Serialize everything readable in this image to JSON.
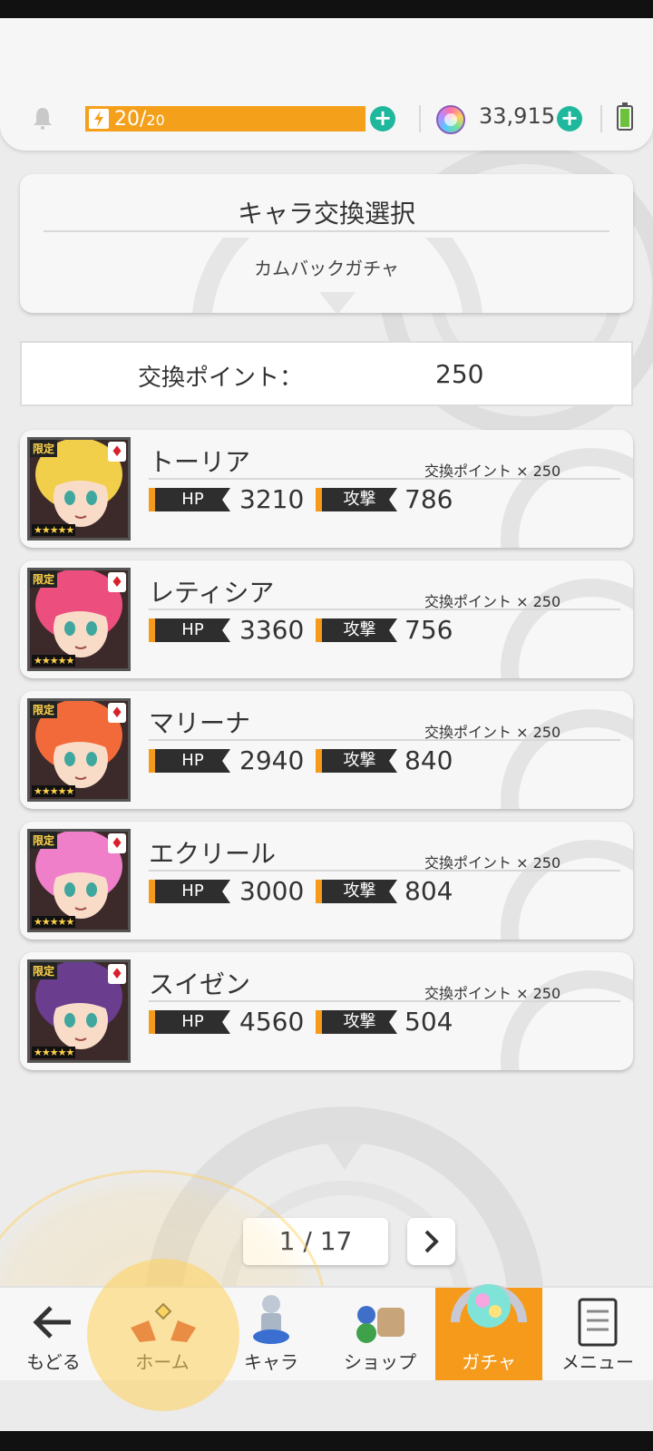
{
  "header": {
    "stamina_current": "20",
    "stamina_max": "20",
    "stamina_fraction": 1.0,
    "gems": "33,915"
  },
  "title_panel": {
    "title": "キャラ交換選択",
    "subtitle": "カムバックガチャ"
  },
  "points": {
    "label": "交換ポイント：",
    "value": "250"
  },
  "card_common": {
    "limited_tag": "限定",
    "stars": "★★★★★",
    "hp_label": "HP",
    "atk_label": "攻撃"
  },
  "characters": [
    {
      "name": "トーリア",
      "cost": "交換ポイント × 250",
      "hp": "3210",
      "atk": "786",
      "hair_color": "#f2cf4a"
    },
    {
      "name": "レティシア",
      "cost": "交換ポイント × 250",
      "hp": "3360",
      "atk": "756",
      "hair_color": "#ec4f7e"
    },
    {
      "name": "マリーナ",
      "cost": "交換ポイント × 250",
      "hp": "2940",
      "atk": "840",
      "hair_color": "#f26a3a"
    },
    {
      "name": "エクリール",
      "cost": "交換ポイント × 250",
      "hp": "3000",
      "atk": "804",
      "hair_color": "#f07fc9"
    },
    {
      "name": "スイゼン",
      "cost": "交換ポイント × 250",
      "hp": "4560",
      "atk": "504",
      "hair_color": "#6a3d8f"
    }
  ],
  "pagination": {
    "label": "1 / 17"
  },
  "nav": {
    "back": "もどる",
    "home": "ホーム",
    "chara": "キャラ",
    "shop": "ショップ",
    "gacha": "ガチャ",
    "menu": "メニュー"
  },
  "colors": {
    "accent_orange": "#f59a1a",
    "plus_green": "#1fb89c",
    "suit_red": "#d9212a"
  },
  "icons": [
    "bell-icon",
    "bolt-icon",
    "plus-icon",
    "gem-icon",
    "battery-icon",
    "chevron-right-icon",
    "back-arrow-icon",
    "home-icon",
    "chara-icon",
    "shop-icon",
    "gacha-icon",
    "menu-icon",
    "diamond-suit-icon"
  ]
}
